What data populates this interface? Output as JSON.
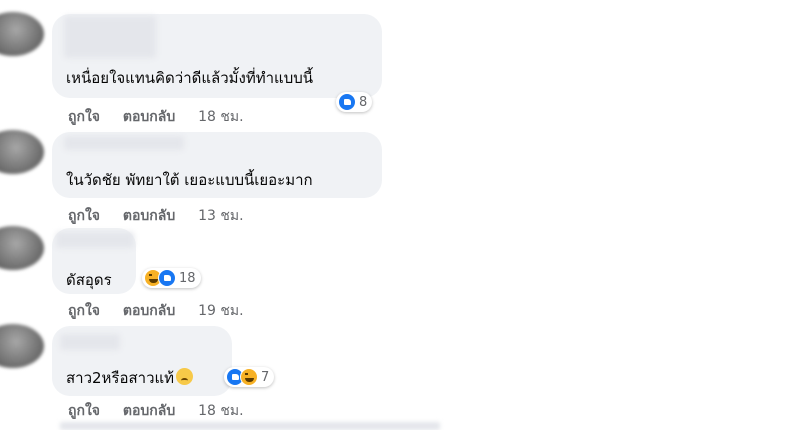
{
  "comments": [
    {
      "text": "เหนื่อยใจแทนคิดว่าดีแล้วมั้งที่ทำแบบนี้",
      "reactions": {
        "types": [
          "like"
        ],
        "count": "8"
      },
      "actions": {
        "like": "ถูกใจ",
        "reply": "ตอบกลับ",
        "time": "18 ชม."
      }
    },
    {
      "text": "ในวัดชัย พัทยาใต้ เยอะแบบนี้เยอะมาก",
      "reactions": null,
      "actions": {
        "like": "ถูกใจ",
        "reply": "ตอบกลับ",
        "time": "13 ชม."
      }
    },
    {
      "text": "ดัสอุดร",
      "reactions": {
        "types": [
          "haha",
          "like"
        ],
        "count": "18"
      },
      "actions": {
        "like": "ถูกใจ",
        "reply": "ตอบกลับ",
        "time": "19 ชม."
      }
    },
    {
      "text": "สาว2หรือสาวแท้",
      "reactions": {
        "types": [
          "like",
          "haha"
        ],
        "count": "7"
      },
      "actions": {
        "like": "ถูกใจ",
        "reply": "ตอบกลับ",
        "time": "18 ชม."
      }
    }
  ]
}
